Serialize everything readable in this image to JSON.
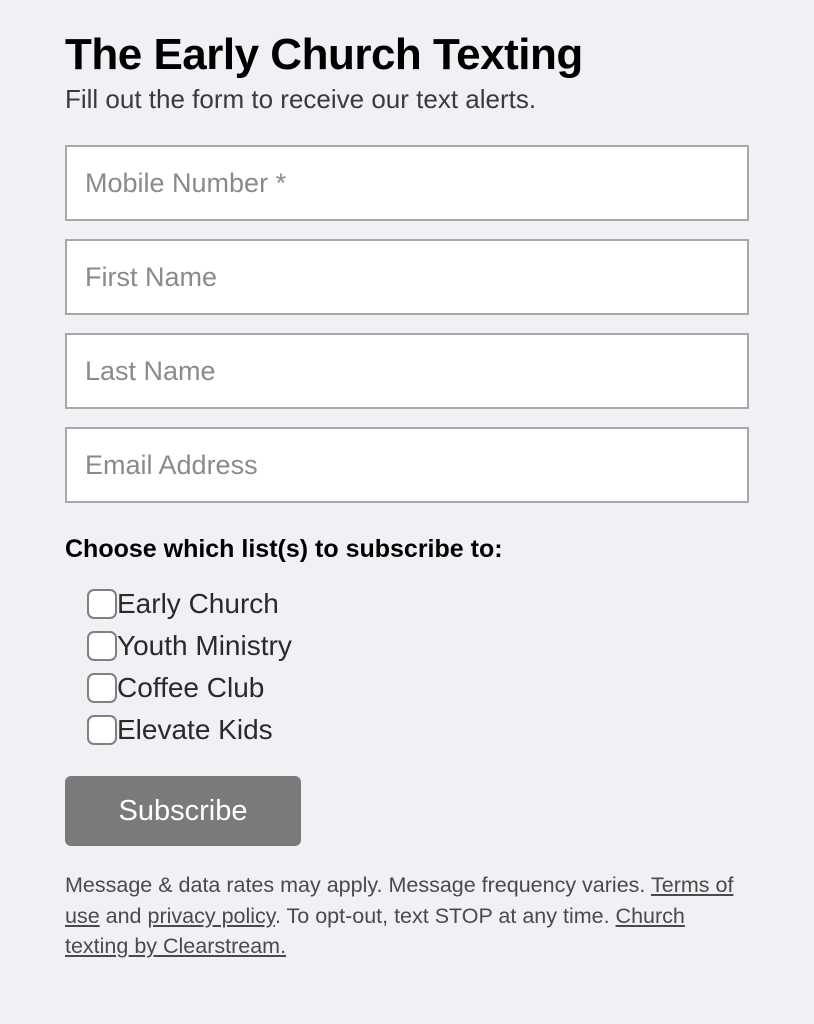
{
  "header": {
    "title": "The Early Church Texting",
    "subtitle": "Fill out the form to receive our text alerts."
  },
  "inputs": {
    "mobile": {
      "placeholder": "Mobile Number *"
    },
    "firstName": {
      "placeholder": "First Name"
    },
    "lastName": {
      "placeholder": "Last Name"
    },
    "email": {
      "placeholder": "Email Address"
    }
  },
  "lists": {
    "heading": "Choose which list(s) to subscribe to:",
    "options": [
      "Early Church",
      "Youth Ministry",
      "Coffee Club",
      "Elevate Kids"
    ]
  },
  "button": {
    "label": "Subscribe"
  },
  "disclaimer": {
    "text1": "Message & data rates may apply. Message frequency varies. ",
    "termsLink": "Terms of use",
    "text2": " and ",
    "privacyLink": "privacy policy",
    "text3": ". To opt-out, text STOP at any time. ",
    "clearstreamLink": "Church texting by Clearstream."
  }
}
